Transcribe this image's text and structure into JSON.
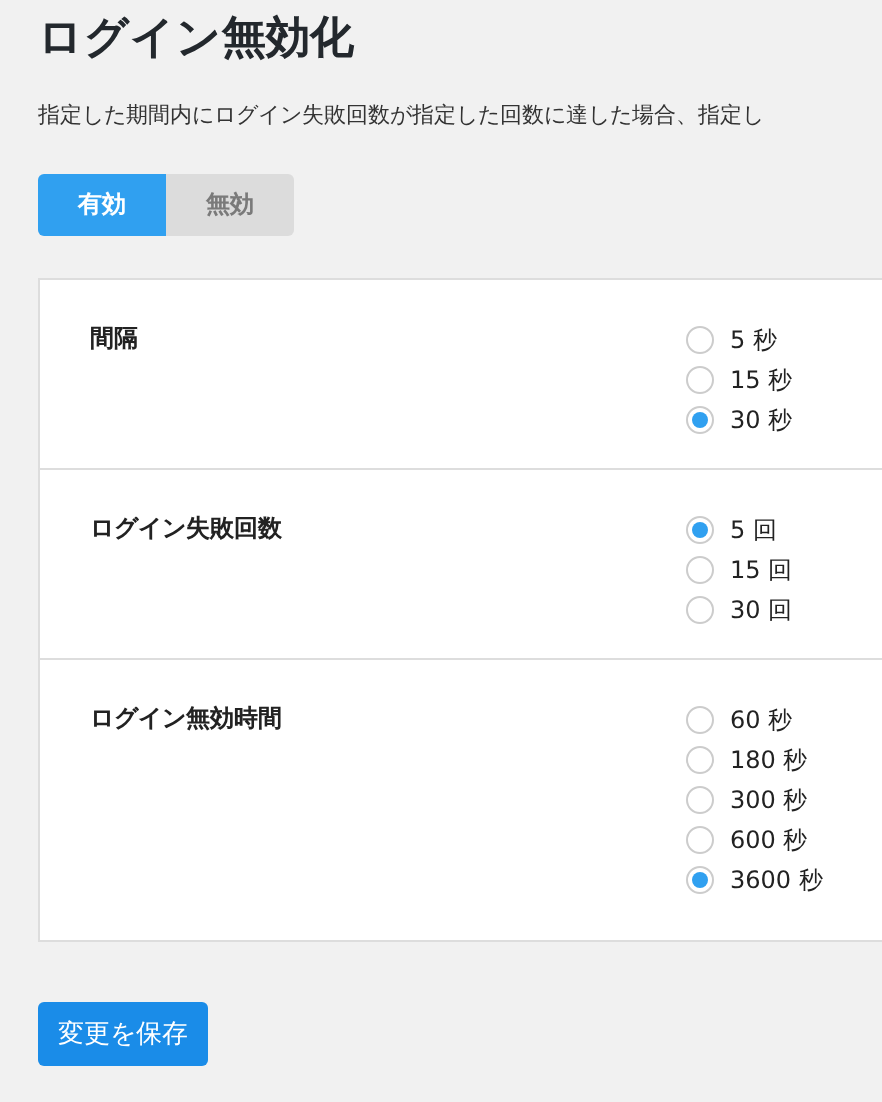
{
  "title": "ログイン無効化",
  "description": "指定した期間内にログイン失敗回数が指定した回数に達した場合、指定し",
  "toggle": [
    {
      "label": "有効",
      "selected": true
    },
    {
      "label": "無効",
      "selected": false
    }
  ],
  "settings": [
    {
      "label": "間隔",
      "options": [
        {
          "label": "5 秒",
          "selected": false
        },
        {
          "label": "15 秒",
          "selected": false
        },
        {
          "label": "30 秒",
          "selected": true
        }
      ]
    },
    {
      "label": "ログイン失敗回数",
      "options": [
        {
          "label": "5 回",
          "selected": true
        },
        {
          "label": "15 回",
          "selected": false
        },
        {
          "label": "30 回",
          "selected": false
        }
      ]
    },
    {
      "label": "ログイン無効時間",
      "options": [
        {
          "label": "60 秒",
          "selected": false
        },
        {
          "label": "180 秒",
          "selected": false
        },
        {
          "label": "300 秒",
          "selected": false
        },
        {
          "label": "600 秒",
          "selected": false
        },
        {
          "label": "3600 秒",
          "selected": true
        }
      ]
    }
  ],
  "save_button": "変更を保存"
}
